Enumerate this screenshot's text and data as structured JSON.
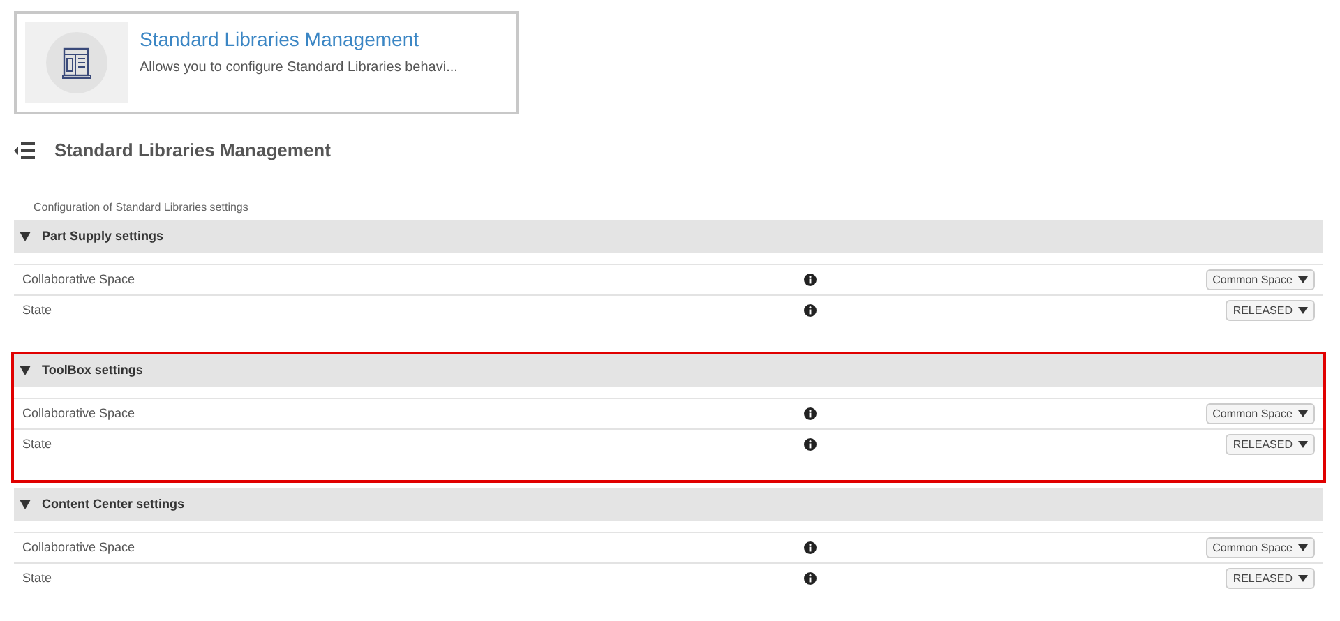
{
  "app_card": {
    "title": "Standard Libraries Management",
    "description": "Allows you to configure Standard Libraries behavi..."
  },
  "page": {
    "title": "Standard Libraries Management",
    "subtitle": "Configuration of Standard Libraries settings"
  },
  "sections": [
    {
      "title": "Part Supply settings",
      "expanded": true,
      "highlighted": false,
      "rows": [
        {
          "label": "Collaborative Space",
          "value": "Common Space"
        },
        {
          "label": "State",
          "value": "RELEASED"
        }
      ]
    },
    {
      "title": "ToolBox settings",
      "expanded": true,
      "highlighted": true,
      "rows": [
        {
          "label": "Collaborative Space",
          "value": "Common Space"
        },
        {
          "label": "State",
          "value": "RELEASED"
        }
      ]
    },
    {
      "title": "Content Center settings",
      "expanded": true,
      "highlighted": false,
      "rows": [
        {
          "label": "Collaborative Space",
          "value": "Common Space"
        },
        {
          "label": "State",
          "value": "RELEASED"
        }
      ]
    }
  ]
}
